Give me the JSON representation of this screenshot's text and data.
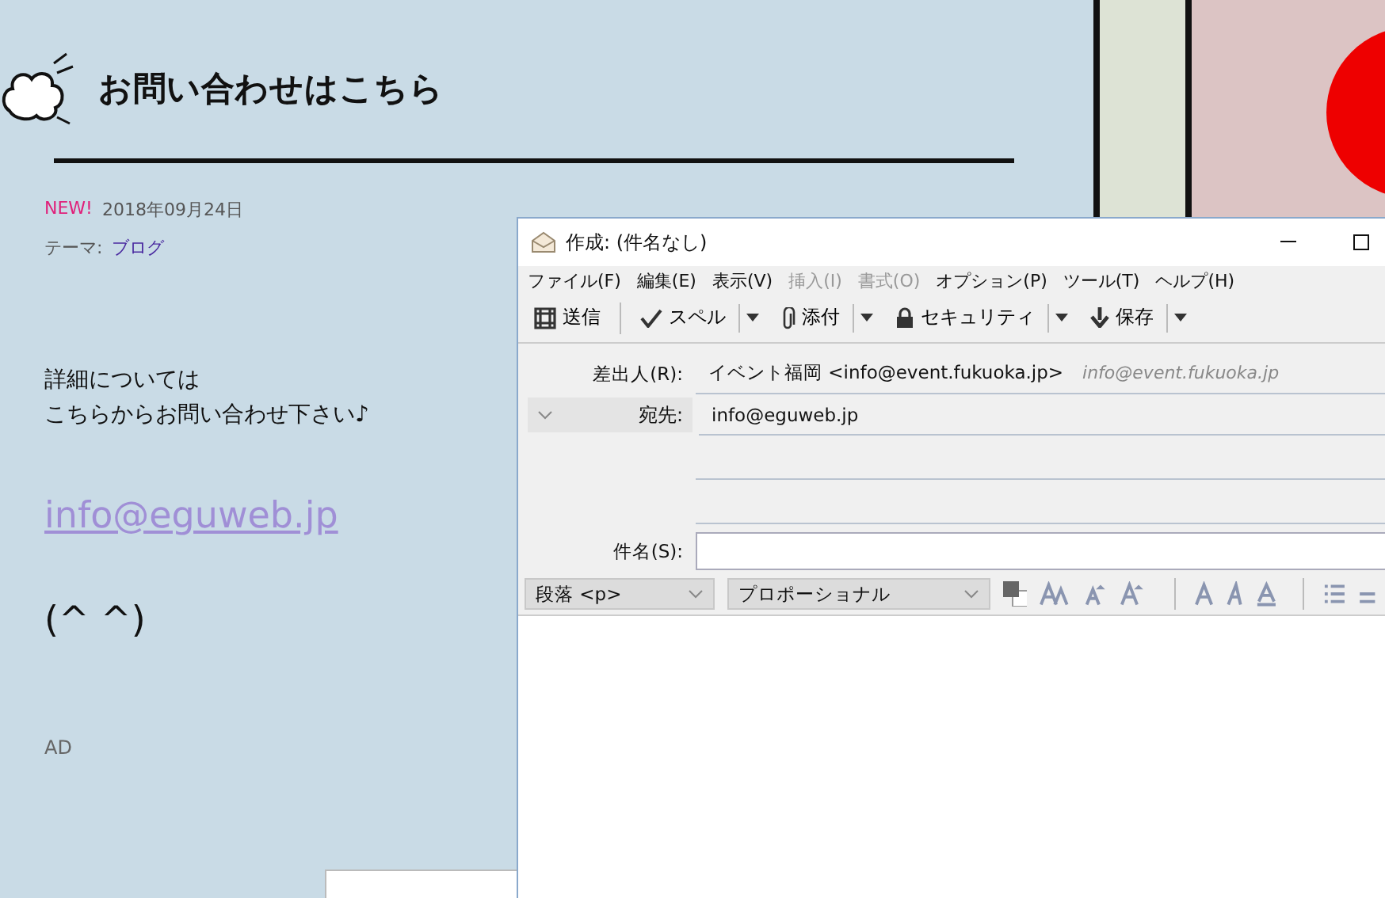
{
  "blog": {
    "title": "お問い合わせはこちら",
    "badge": "NEW!",
    "date": "2018年09月24日",
    "theme_label": "テーマ:",
    "theme_link": "ブログ",
    "body_lines": [
      "詳細については",
      "こちらからお問い合わせ下さい♪"
    ],
    "email_link": "info@eguweb.jp",
    "emoticon": "(^ ^)",
    "ad_label": "AD"
  },
  "compose_window": {
    "title": "作成: (件名なし)",
    "menu": [
      {
        "label": "ファイル(F)",
        "disabled": false
      },
      {
        "label": "編集(E)",
        "disabled": false
      },
      {
        "label": "表示(V)",
        "disabled": false
      },
      {
        "label": "挿入(I)",
        "disabled": true
      },
      {
        "label": "書式(O)",
        "disabled": true
      },
      {
        "label": "オプション(P)",
        "disabled": false
      },
      {
        "label": "ツール(T)",
        "disabled": false
      },
      {
        "label": "ヘルプ(H)",
        "disabled": false
      }
    ],
    "toolbar": [
      {
        "kind": "send",
        "label": "送信",
        "dropdown": false
      },
      {
        "kind": "spell",
        "label": "スペル",
        "dropdown": true
      },
      {
        "kind": "attach",
        "label": "添付",
        "dropdown": true
      },
      {
        "kind": "security",
        "label": "セキュリティ",
        "dropdown": true
      },
      {
        "kind": "save",
        "label": "保存",
        "dropdown": true
      }
    ],
    "from_label": "差出人(R):",
    "from_value": "イベント福岡 <info@event.fukuoka.jp>",
    "from_hint": "info@event.fukuoka.jp",
    "to_label": "宛先:",
    "to_value": "info@eguweb.jp",
    "subject_label": "件名(S):",
    "paragraph_select": "段落 <p>",
    "font_select": "プロポーショナル"
  }
}
